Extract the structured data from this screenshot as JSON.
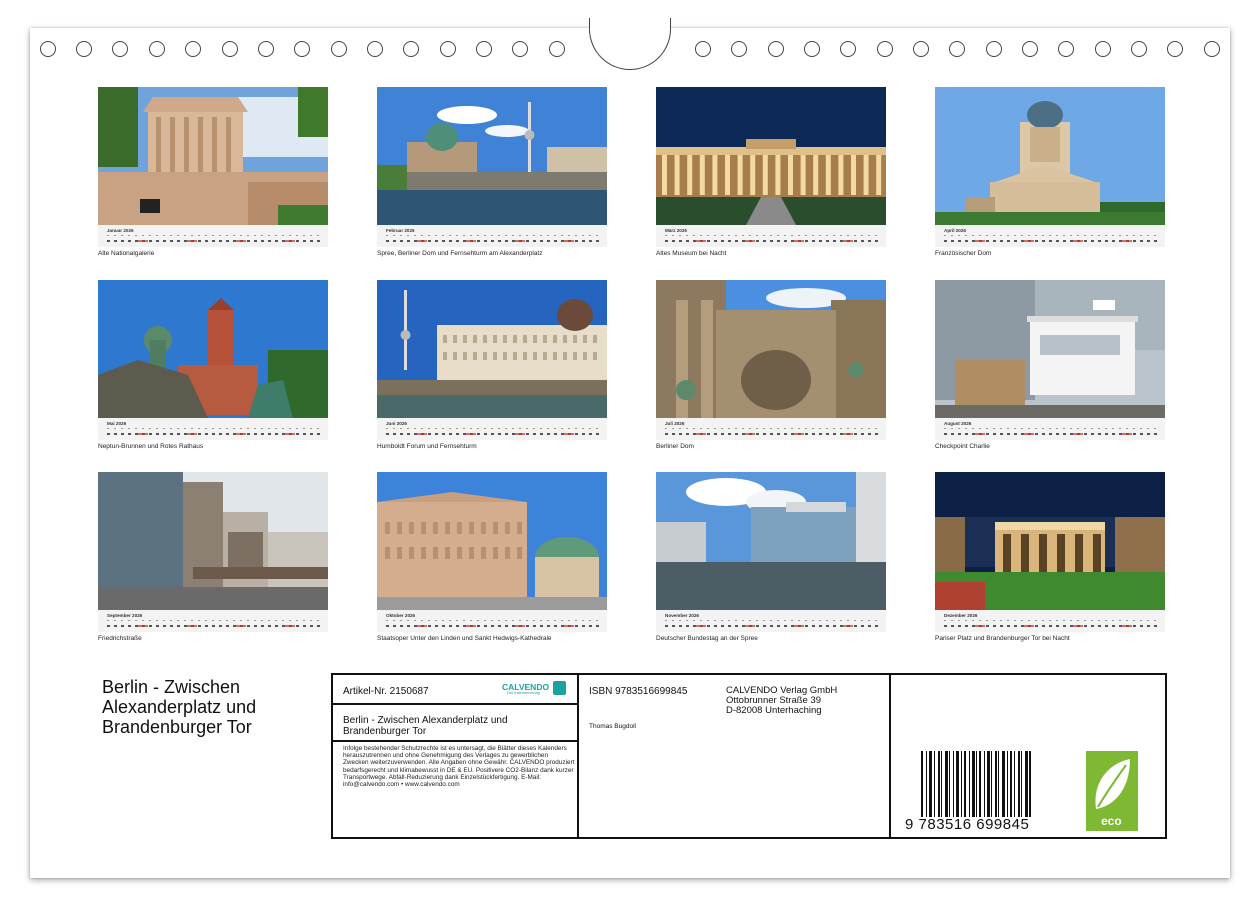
{
  "months": [
    {
      "label": "Januar 2026",
      "caption": "Alte Nationalgalerie"
    },
    {
      "label": "Februar 2026",
      "caption": "Spree, Berliner Dom und Fernsehturm am Alexanderplatz"
    },
    {
      "label": "März 2026",
      "caption": "Altes Museum bei Nacht"
    },
    {
      "label": "April 2026",
      "caption": "Französischer Dom"
    },
    {
      "label": "Mai 2026",
      "caption": "Neptun-Brunnen und Rotes Rathaus"
    },
    {
      "label": "Juni 2026",
      "caption": "Humboldt Forum und Fernsehturm"
    },
    {
      "label": "Juli 2026",
      "caption": "Berliner Dom"
    },
    {
      "label": "August 2026",
      "caption": "Checkpoint Charlie"
    },
    {
      "label": "September 2026",
      "caption": "Friedrichstraße"
    },
    {
      "label": "Oktober 2026",
      "caption": "Staatsoper Unter den Linden und Sankt Hedwigs-Kathedrale"
    },
    {
      "label": "November 2026",
      "caption": "Deutscher Bundestag an der Spree"
    },
    {
      "label": "Dezember 2026",
      "caption": "Pariser Platz und Brandenburger Tor bei Nacht"
    }
  ],
  "title": "Berlin - Zwischen Alexanderplatz und Brandenburger Tor",
  "info": {
    "article": "Artikel-Nr. 2150687",
    "brand": "CALVENDO",
    "brand_sub": "Der Kalenderverlag",
    "box_title": "Berlin - Zwischen Alexanderplatz und Brandenburger Tor",
    "legal": "Infolge bestehender Schutzrechte ist es untersagt, die Blätter dieses Kalenders herauszutrennen und ohne Genehmigung des Verlages zu gewerblichen Zwecken weiterzuverwenden. Alle Angaben ohne Gewähr. CALVENDO produziert bedarfsgerecht und klimabewusst in DE & EU. Positivere CO2-Bilanz dank kurzer Transportwege. Abfall-Reduzierung dank Einzelstückfertigung. E-Mail: info@calvendo.com • www.calvendo.com",
    "isbn": "ISBN 9783516699845",
    "publisher_1": "CALVENDO Verlag GmbH",
    "publisher_2": "Ottobrunner Straße 39",
    "publisher_3": "D-82008 Unterhaching",
    "author": "Thomas Bugdoll",
    "barcode_digits": "9 783516 699845",
    "eco_label": "eco"
  },
  "colors": {
    "eco_green": "#7fb832",
    "calvendo_teal": "#1aa3a0"
  }
}
